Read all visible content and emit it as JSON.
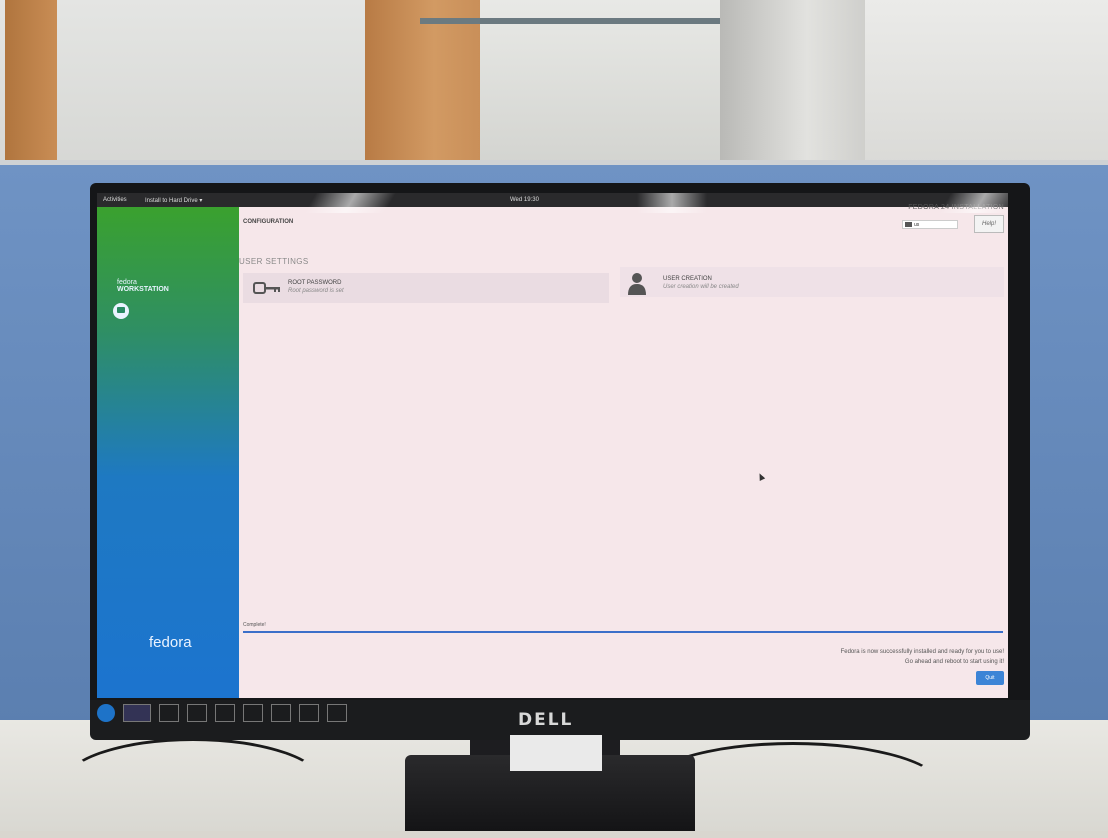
{
  "topbar": {
    "activities": "Activities",
    "app_menu": "Install to Hard Drive ▾",
    "clock": "Wed 19:30"
  },
  "sidebar": {
    "brand_small": "fedora",
    "edition": "WORKSTATION",
    "brand_bottom": "fedora"
  },
  "header": {
    "section": "CONFIGURATION",
    "install_title": "FEDORA 24 INSTALLATION",
    "keyboard_layout": "us",
    "help_label": "Help!"
  },
  "user_settings": {
    "title": "USER SETTINGS",
    "root": {
      "title": "ROOT PASSWORD",
      "status": "Root password is set"
    },
    "user": {
      "title": "USER CREATION",
      "status": "User creation will be created"
    }
  },
  "footer": {
    "complete": "Complete!",
    "progress": 1.0,
    "message_line1": "Fedora is now successfully installed and ready for you to use!",
    "message_line2": "Go ahead and reboot to start using it!",
    "quit_label": "Quit"
  },
  "monitor": {
    "brand": "DELL"
  },
  "colors": {
    "accent": "#3c84d6",
    "screen_bg": "#f6e7ea",
    "sidebar_green": "#3aa12e",
    "sidebar_blue": "#1c74cf"
  }
}
